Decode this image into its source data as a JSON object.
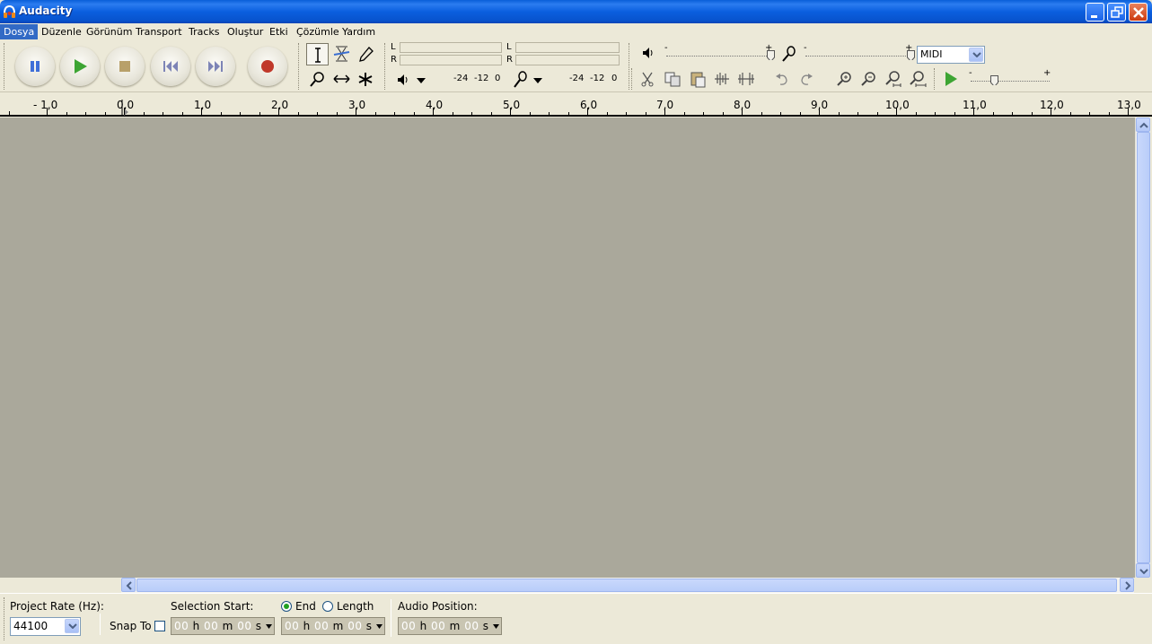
{
  "window": {
    "title": "Audacity"
  },
  "menu": [
    "Dosya",
    "Düzenle",
    "Görünüm",
    "Transport",
    "Tracks",
    "Oluştur",
    "Etki",
    "Çözümle",
    "Yardım"
  ],
  "meters": {
    "output_l": "L",
    "output_r": "R",
    "input_l": "L",
    "input_r": "R",
    "output_scale": [
      "-24",
      "-12",
      "0"
    ],
    "input_scale": [
      "-24",
      "-12",
      "0"
    ]
  },
  "mixer": {
    "minus1": "-",
    "plus1": "+",
    "minus2": "-",
    "plus2": "+",
    "minus3": "-",
    "plus3": "+",
    "midi_value": "MIDI"
  },
  "ruler": {
    "labels": [
      "- 1,0",
      "0,0",
      "1,0",
      "2,0",
      "3,0",
      "4,0",
      "5,0",
      "6,0",
      "7,0",
      "8,0",
      "9,0",
      "10,0",
      "11,0",
      "12,0",
      "13,0"
    ]
  },
  "selection_bar": {
    "project_rate_label": "Project Rate (Hz):",
    "project_rate_value": "44100",
    "snap_to_label": "Snap To",
    "selection_start_label": "Selection Start:",
    "end_label": "End",
    "length_label": "Length",
    "audio_position_label": "Audio Position:",
    "time_units": [
      "h",
      "m",
      "s"
    ],
    "time_digits": [
      "00",
      "00",
      "00"
    ]
  },
  "colors": {
    "titlebar": "#0a5fd8",
    "track_area": "#aaa89b",
    "menu_highlight": "#316ac5",
    "record": "#c0392b",
    "play": "#3da533"
  },
  "icons": [
    "audacity-app-icon",
    "pause-icon",
    "play-icon",
    "stop-icon",
    "skip-start-icon",
    "skip-end-icon",
    "record-icon",
    "selection-tool-icon",
    "envelope-tool-icon",
    "draw-tool-icon",
    "zoom-tool-icon",
    "timeshift-tool-icon",
    "multi-tool-icon",
    "speaker-icon",
    "microphone-icon",
    "trim-icon",
    "copy-icon",
    "paste-icon",
    "silence-icon",
    "undo-icon",
    "redo-icon",
    "zoom-in-icon",
    "zoom-out-icon",
    "fit-selection-icon",
    "fit-project-icon"
  ]
}
